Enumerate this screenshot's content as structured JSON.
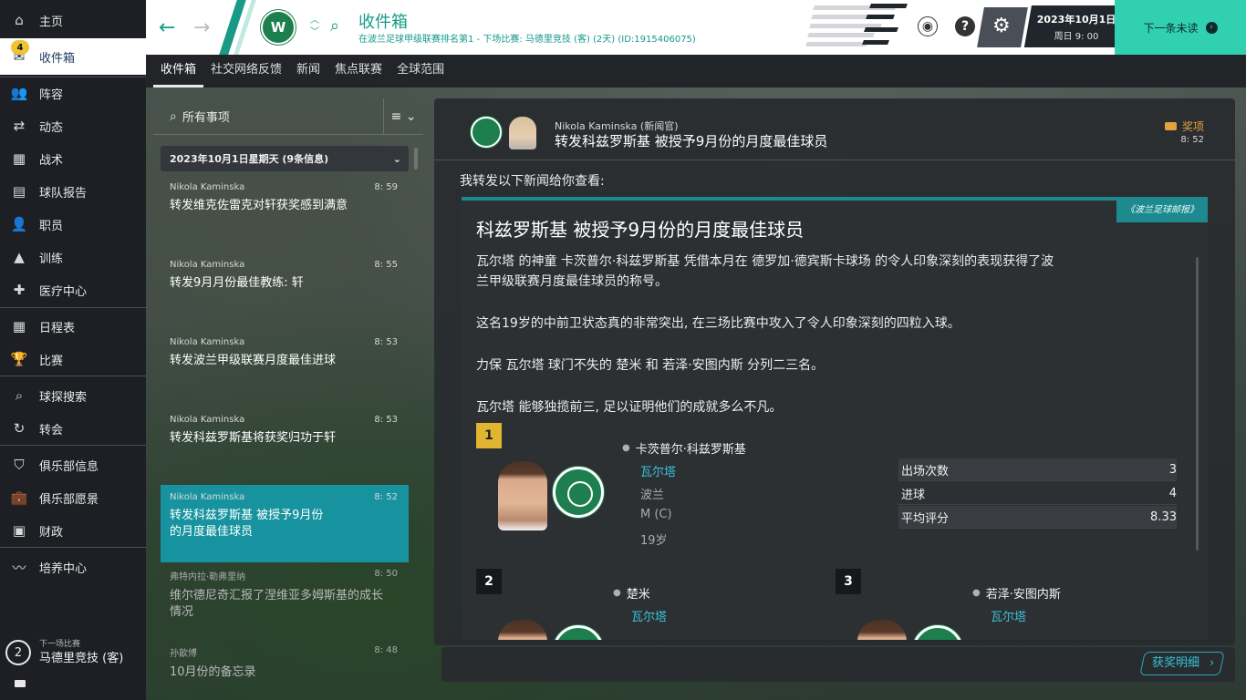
{
  "sidebar": {
    "badge": "4",
    "items": [
      {
        "label": "主页",
        "icon": "home-icon"
      },
      {
        "label": "收件箱",
        "icon": "inbox-icon"
      },
      {
        "label": "阵容",
        "icon": "squad-icon"
      },
      {
        "label": "动态",
        "icon": "dynamics-icon"
      },
      {
        "label": "战术",
        "icon": "tactics-icon"
      },
      {
        "label": "球队报告",
        "icon": "report-icon"
      },
      {
        "label": "职员",
        "icon": "staff-icon"
      },
      {
        "label": "训练",
        "icon": "training-icon"
      },
      {
        "label": "医疗中心",
        "icon": "medical-icon"
      },
      {
        "label": "日程表",
        "icon": "calendar-icon"
      },
      {
        "label": "比赛",
        "icon": "trophy-icon"
      },
      {
        "label": "球探搜索",
        "icon": "search-icon"
      },
      {
        "label": "转会",
        "icon": "transfer-icon"
      },
      {
        "label": "俱乐部信息",
        "icon": "shield-icon"
      },
      {
        "label": "俱乐部愿景",
        "icon": "briefcase-icon"
      },
      {
        "label": "财政",
        "icon": "money-icon"
      },
      {
        "label": "培养中心",
        "icon": "development-icon"
      }
    ],
    "next_match": {
      "days": "2",
      "label": "下一场比赛",
      "opponent": "马德里竞技 (客)"
    }
  },
  "topbar": {
    "title": "收件箱",
    "subtitle": "在波兰足球甲级联赛排名第1 - 下场比赛: 马德里竞技 (客) (2天) (ID:1915406075)",
    "date": "2023年10月1日",
    "time": "周日 9: 00",
    "continue_label": "下一条未读",
    "colors": {
      "accent": "#169a8a",
      "continue_bg": "#31d0b1"
    }
  },
  "tabs": [
    "收件箱",
    "社交网络反馈",
    "新闻",
    "焦点联赛",
    "全球范围"
  ],
  "inbox": {
    "search_label": "所有事项",
    "date_header": "2023年10月1日星期天 (9条信息)",
    "messages": [
      {
        "from": "Nikola Kaminska",
        "time": "8: 59",
        "subject": "转发维克佐雷克对轩获奖感到满意"
      },
      {
        "from": "Nikola Kaminska",
        "time": "8: 55",
        "subject": "转发9月月份最佳教练: 轩"
      },
      {
        "from": "Nikola Kaminska",
        "time": "8: 53",
        "subject": "转发波兰甲级联赛月度最佳进球"
      },
      {
        "from": "Nikola Kaminska",
        "time": "8: 53",
        "subject": "转发科兹罗斯基将获奖归功于轩"
      },
      {
        "from": "Nikola Kaminska",
        "time": "8: 52",
        "subject": "转发科兹罗斯基 被授予9月份的月度最佳球员"
      },
      {
        "from": "弗特内拉·勒弗里纳",
        "time": "8: 50",
        "subject": "维尔德尼奇汇报了涅维亚多姆斯基的成长情况"
      },
      {
        "from": "孙歆博",
        "time": "8: 48",
        "subject": "10月份的备忘录"
      }
    ]
  },
  "message": {
    "from": "Nikola Kaminska (新闻官)",
    "subject": "转发科兹罗斯基 被授予9月份的月度最佳球员",
    "tag": "奖项",
    "time": "8: 52",
    "intro": "我转发以下新闻给你查看:",
    "source": "《波兰足球邮报》",
    "headline": "科兹罗斯基 被授予9月份的月度最佳球员",
    "paragraphs": [
      "瓦尔塔 的神童 卡茨普尔·科兹罗斯基 凭借本月在 德罗加·德宾斯卡球场 的令人印象深刻的表现获得了波兰甲级联赛月度最佳球员的称号。",
      "这名19岁的中前卫状态真的非常突出, 在三场比赛中攻入了令人印象深刻的四粒入球。",
      "力保 瓦尔塔 球门不失的 楚米 和 若泽·安图内斯 分列二三名。",
      "瓦尔塔 能够独揽前三, 足以证明他们的成就多么不凡。"
    ],
    "winner": {
      "rank": "1",
      "name": "卡茨普尔·科兹罗斯基",
      "club": "瓦尔塔",
      "nation": "波兰",
      "position": "M (C)",
      "age": "19岁",
      "stats": [
        {
          "label": "出场次数",
          "value": "3"
        },
        {
          "label": "进球",
          "value": "4"
        },
        {
          "label": "平均评分",
          "value": "8.33"
        }
      ]
    },
    "second": {
      "rank": "2",
      "name": "楚米",
      "club": "瓦尔塔"
    },
    "third": {
      "rank": "3",
      "name": "若泽·安图内斯",
      "club": "瓦尔塔"
    },
    "award_button": "获奖明细"
  }
}
